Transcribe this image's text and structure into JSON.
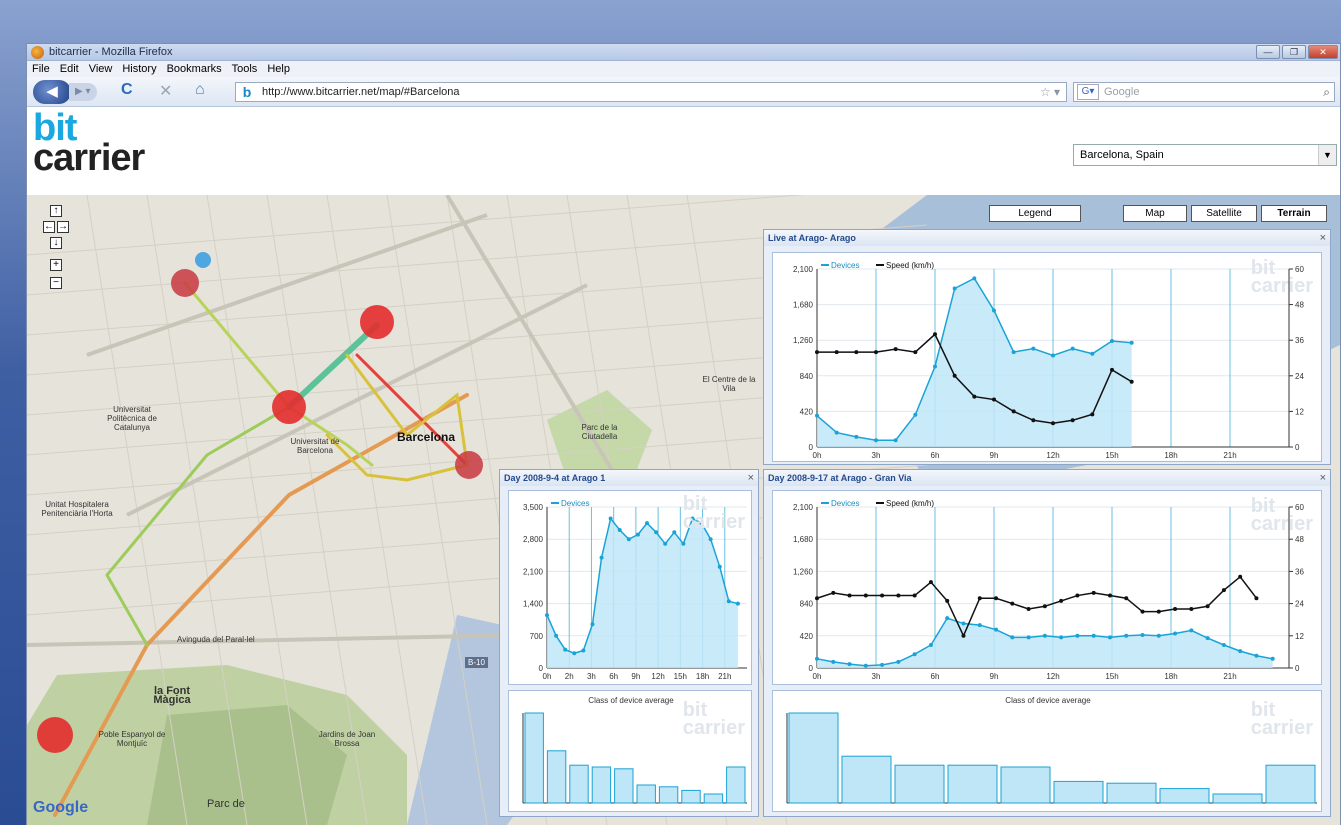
{
  "window": {
    "title": "bitcarrier - Mozilla Firefox",
    "buttons": [
      "—",
      "❐",
      "✕"
    ]
  },
  "menu": [
    "File",
    "Edit",
    "View",
    "History",
    "Bookmarks",
    "Tools",
    "Help"
  ],
  "nav": {
    "url": "http://www.bitcarrier.net/map/#Barcelona",
    "search_placeholder": "Google"
  },
  "logo": {
    "line1": "bit",
    "line2": "carrier"
  },
  "location": {
    "selected": "Barcelona, Spain"
  },
  "map": {
    "buttons": {
      "legend": "Legend",
      "map": "Map",
      "satellite": "Satellite",
      "terrain": "Terrain"
    },
    "zoom": [
      "↑",
      "←",
      "→",
      "↓",
      "+",
      "−"
    ],
    "labels": {
      "barcelona": "Barcelona",
      "uni_catalunya": "Universitat Politècnica de Catalunya",
      "uni_barcelona": "Universitat de Barcelona",
      "parc_ciutadella": "Parc de la Ciutadella",
      "el_centre": "El Centre de la Vila",
      "hospitalet": "Unitat Hospitalera Penitenciària l'Horta",
      "font_magica": "la Font Màgica",
      "poble_espanyol": "Poble Espanyol de Montjuïc",
      "jardins": "Jardins de Joan Brossa",
      "parc_de": "Parc de",
      "paral": "Avinguda del Paral·lel",
      "b10": "B-10",
      "google": "Google"
    }
  },
  "panels": {
    "live": {
      "title": "Live at Arago- Arago",
      "close": "×"
    },
    "day1": {
      "title": "Day 2008-9-4 at Arago 1",
      "close": "×",
      "sub_title": "Class of device average"
    },
    "day2": {
      "title": "Day 2008-9-17 at Arago - Gran Via",
      "close": "×",
      "sub_title": "Class of device average"
    },
    "watermark": {
      "line1": "bit",
      "line2": "carrier"
    }
  },
  "chart_data": [
    {
      "type": "area",
      "panel": "Live at Arago- Arago",
      "x": [
        "0h",
        "3h",
        "6h",
        "9h",
        "12h",
        "15h",
        "18h",
        "21h"
      ],
      "ylim": [
        0,
        2100
      ],
      "y_ticks": [
        "0",
        "420",
        "840",
        "1,260",
        "1,680",
        "2,100"
      ],
      "y2lim": [
        0,
        60
      ],
      "y2_ticks": [
        "0",
        "12",
        "24",
        "36",
        "48",
        "60"
      ],
      "series": [
        {
          "name": "Devices",
          "axis": "left",
          "color": "#1aa3d6",
          "values": [
            370,
            170,
            120,
            80,
            80,
            380,
            950,
            1870,
            1990,
            1610,
            1120,
            1160,
            1080,
            1160,
            1100,
            1250,
            1230
          ]
        },
        {
          "name": "Speed (km/h)",
          "axis": "right",
          "color": "#111111",
          "values": [
            32,
            32,
            32,
            32,
            33,
            32,
            38,
            24,
            17,
            16,
            12,
            9,
            8,
            9,
            11,
            26,
            22
          ]
        }
      ]
    },
    {
      "type": "area",
      "panel": "Day 2008-9-4 at Arago 1",
      "x": [
        "0h",
        "2h",
        "3h",
        "6h",
        "9h",
        "12h",
        "15h",
        "18h",
        "21h"
      ],
      "ylim": [
        0,
        3500
      ],
      "y_ticks": [
        "0",
        "700",
        "1,400",
        "2,100",
        "2,800",
        "3,500"
      ],
      "series": [
        {
          "name": "Devices",
          "axis": "left",
          "color": "#1aa3d6",
          "values": [
            1150,
            700,
            400,
            320,
            380,
            950,
            2400,
            3250,
            3000,
            2800,
            2900,
            3150,
            2950,
            2700,
            2950,
            2700,
            3250,
            3150,
            2800,
            2200,
            1450,
            1400
          ]
        }
      ]
    },
    {
      "type": "bar",
      "panel": "Day 2008-9-4 at Arago 1",
      "title": "Class of device average",
      "values": [
        100,
        58,
        42,
        40,
        38,
        20,
        18,
        14,
        10,
        40
      ]
    },
    {
      "type": "area",
      "panel": "Day 2008-9-17 at Arago - Gran Via",
      "x": [
        "0h",
        "3h",
        "6h",
        "9h",
        "12h",
        "15h",
        "18h",
        "21h"
      ],
      "ylim": [
        0,
        2100
      ],
      "y_ticks": [
        "0",
        "420",
        "840",
        "1,260",
        "1,680",
        "2,100"
      ],
      "y2lim": [
        0,
        60
      ],
      "y2_ticks": [
        "0",
        "12",
        "24",
        "36",
        "48",
        "60"
      ],
      "series": [
        {
          "name": "Devices",
          "axis": "left",
          "color": "#1aa3d6",
          "values": [
            120,
            80,
            50,
            30,
            40,
            80,
            180,
            300,
            650,
            580,
            560,
            500,
            400,
            400,
            420,
            400,
            420,
            420,
            400,
            420,
            430,
            420,
            450,
            490,
            390,
            300,
            220,
            160,
            120
          ]
        },
        {
          "name": "Speed (km/h)",
          "axis": "right",
          "color": "#111111",
          "values": [
            26,
            28,
            27,
            27,
            27,
            27,
            27,
            32,
            25,
            12,
            26,
            26,
            24,
            22,
            23,
            25,
            27,
            28,
            27,
            26,
            21,
            21,
            22,
            22,
            23,
            29,
            34,
            26
          ]
        }
      ]
    },
    {
      "type": "bar",
      "panel": "Day 2008-9-17 at Arago - Gran Via",
      "title": "Class of device average",
      "values": [
        100,
        52,
        42,
        42,
        40,
        24,
        22,
        16,
        10,
        42
      ]
    }
  ]
}
